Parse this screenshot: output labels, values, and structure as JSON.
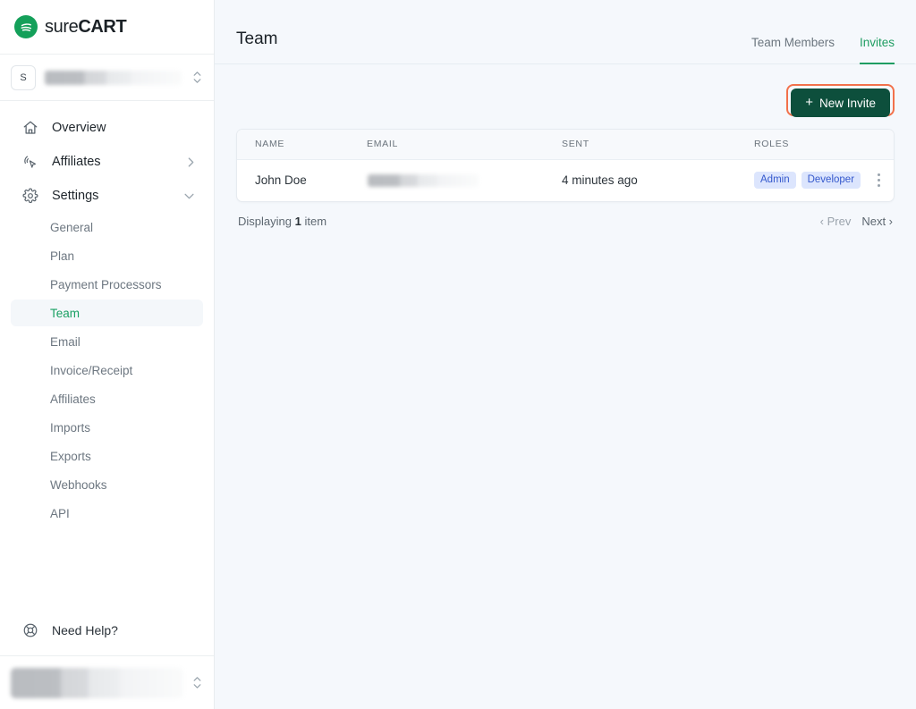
{
  "brand": {
    "logo_icon": "surecart-logo-icon",
    "name_light": "sure",
    "name_bold": "CART",
    "accent_green": "#14a05a",
    "active_green": "#1f9d62",
    "button_green": "#0d4f3c",
    "highlight_orange": "#f2714b",
    "badge_bg": "#dce5fd",
    "badge_text": "#3559cd"
  },
  "sidebar": {
    "store_selector": {
      "avatar_initial": "S",
      "name": "",
      "icon": "chevron-up-down-icon"
    },
    "nav": [
      {
        "label": "Overview",
        "icon": "home-icon",
        "caret": ""
      },
      {
        "label": "Affiliates",
        "icon": "cursor-click-icon",
        "caret": "chevron-right-icon"
      },
      {
        "label": "Settings",
        "icon": "gear-icon",
        "caret": "chevron-down-icon"
      }
    ],
    "settings_submenu": [
      {
        "label": "General",
        "active": false
      },
      {
        "label": "Plan",
        "active": false
      },
      {
        "label": "Payment Processors",
        "active": false
      },
      {
        "label": "Team",
        "active": true
      },
      {
        "label": "Email",
        "active": false
      },
      {
        "label": "Invoice/Receipt",
        "active": false
      },
      {
        "label": "Affiliates",
        "active": false
      },
      {
        "label": "Imports",
        "active": false
      },
      {
        "label": "Exports",
        "active": false
      },
      {
        "label": "Webhooks",
        "active": false
      },
      {
        "label": "API",
        "active": false
      }
    ],
    "help": {
      "label": "Need Help?",
      "icon": "lifebuoy-icon"
    },
    "user_bar": {
      "name": "",
      "icon": "chevron-up-down-icon"
    }
  },
  "header": {
    "title": "Team",
    "tabs": [
      {
        "label": "Team Members",
        "active": false
      },
      {
        "label": "Invites",
        "active": true
      }
    ]
  },
  "toolbar": {
    "new_invite_label": "New Invite",
    "new_invite_icon": "plus-icon",
    "highlighted": true
  },
  "table": {
    "columns": [
      "NAME",
      "EMAIL",
      "SENT",
      "ROLES"
    ],
    "rows": [
      {
        "name": "John Doe",
        "email": "",
        "sent": "4 minutes ago",
        "roles": [
          "Admin",
          "Developer"
        ],
        "actions_icon": "kebab-menu-icon"
      }
    ]
  },
  "pagination": {
    "prefix": "Displaying",
    "count": "1",
    "suffix": "item",
    "prev_label": "‹ Prev",
    "next_label": "Next ›"
  }
}
